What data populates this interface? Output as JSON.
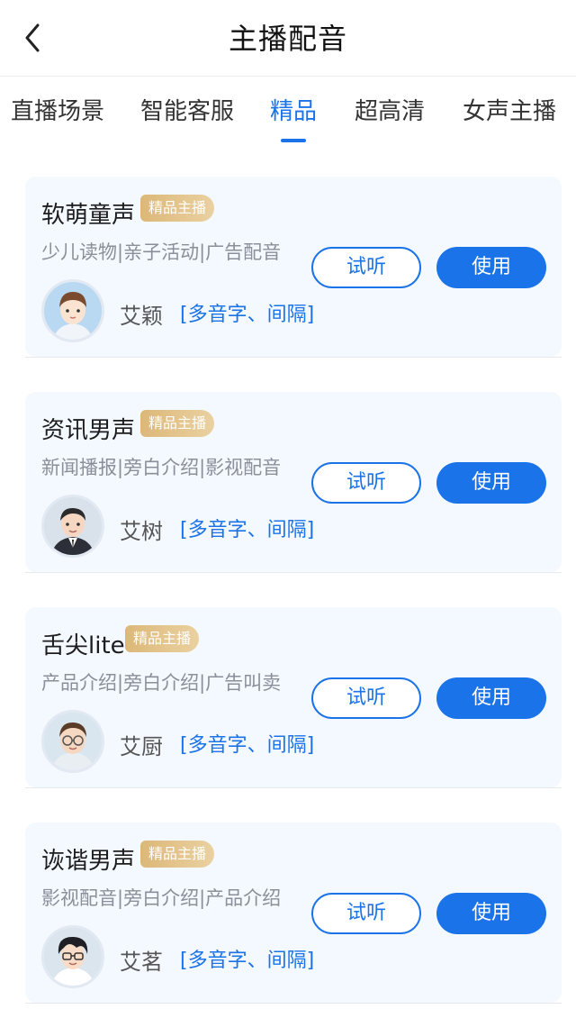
{
  "header": {
    "title": "主播配音",
    "back_icon": "chevron-left-icon"
  },
  "tabs": [
    {
      "label": "直播场景",
      "active": false
    },
    {
      "label": "智能客服",
      "active": false
    },
    {
      "label": "精品",
      "active": true
    },
    {
      "label": "超高清",
      "active": false
    },
    {
      "label": "女声主播",
      "active": false
    }
  ],
  "colors": {
    "accent": "#1a73e8",
    "badge_gold": "#dcb878",
    "card_bg": "#f4f8ff"
  },
  "cards": [
    {
      "name": "软萌童声",
      "badge": "精品主播",
      "tags": "少儿读物|亲子活动|广告配音",
      "voice_name": "艾颖",
      "features": "[多音字、间隔]",
      "try_label": "试听",
      "use_label": "使用",
      "avatar_icon": "child-avatar-icon"
    },
    {
      "name": "资讯男声",
      "badge": "精品主播",
      "tags": "新闻播报|旁白介绍|影视配音",
      "voice_name": "艾树",
      "features": "[多音字、间隔]",
      "try_label": "试听",
      "use_label": "使用",
      "avatar_icon": "man-suit-avatar-icon"
    },
    {
      "name": "舌尖lite",
      "badge": "精品主播",
      "tags": "产品介绍|旁白介绍|广告叫卖",
      "voice_name": "艾厨",
      "features": "[多音字、间隔]",
      "try_label": "试听",
      "use_label": "使用",
      "avatar_icon": "man-glasses-avatar-icon"
    },
    {
      "name": "诙谐男声",
      "badge": "精品主播",
      "tags": "影视配音|旁白介绍|产品介绍",
      "voice_name": "艾茗",
      "features": "[多音字、间隔]",
      "try_label": "试听",
      "use_label": "使用",
      "avatar_icon": "young-man-glasses-avatar-icon"
    }
  ]
}
